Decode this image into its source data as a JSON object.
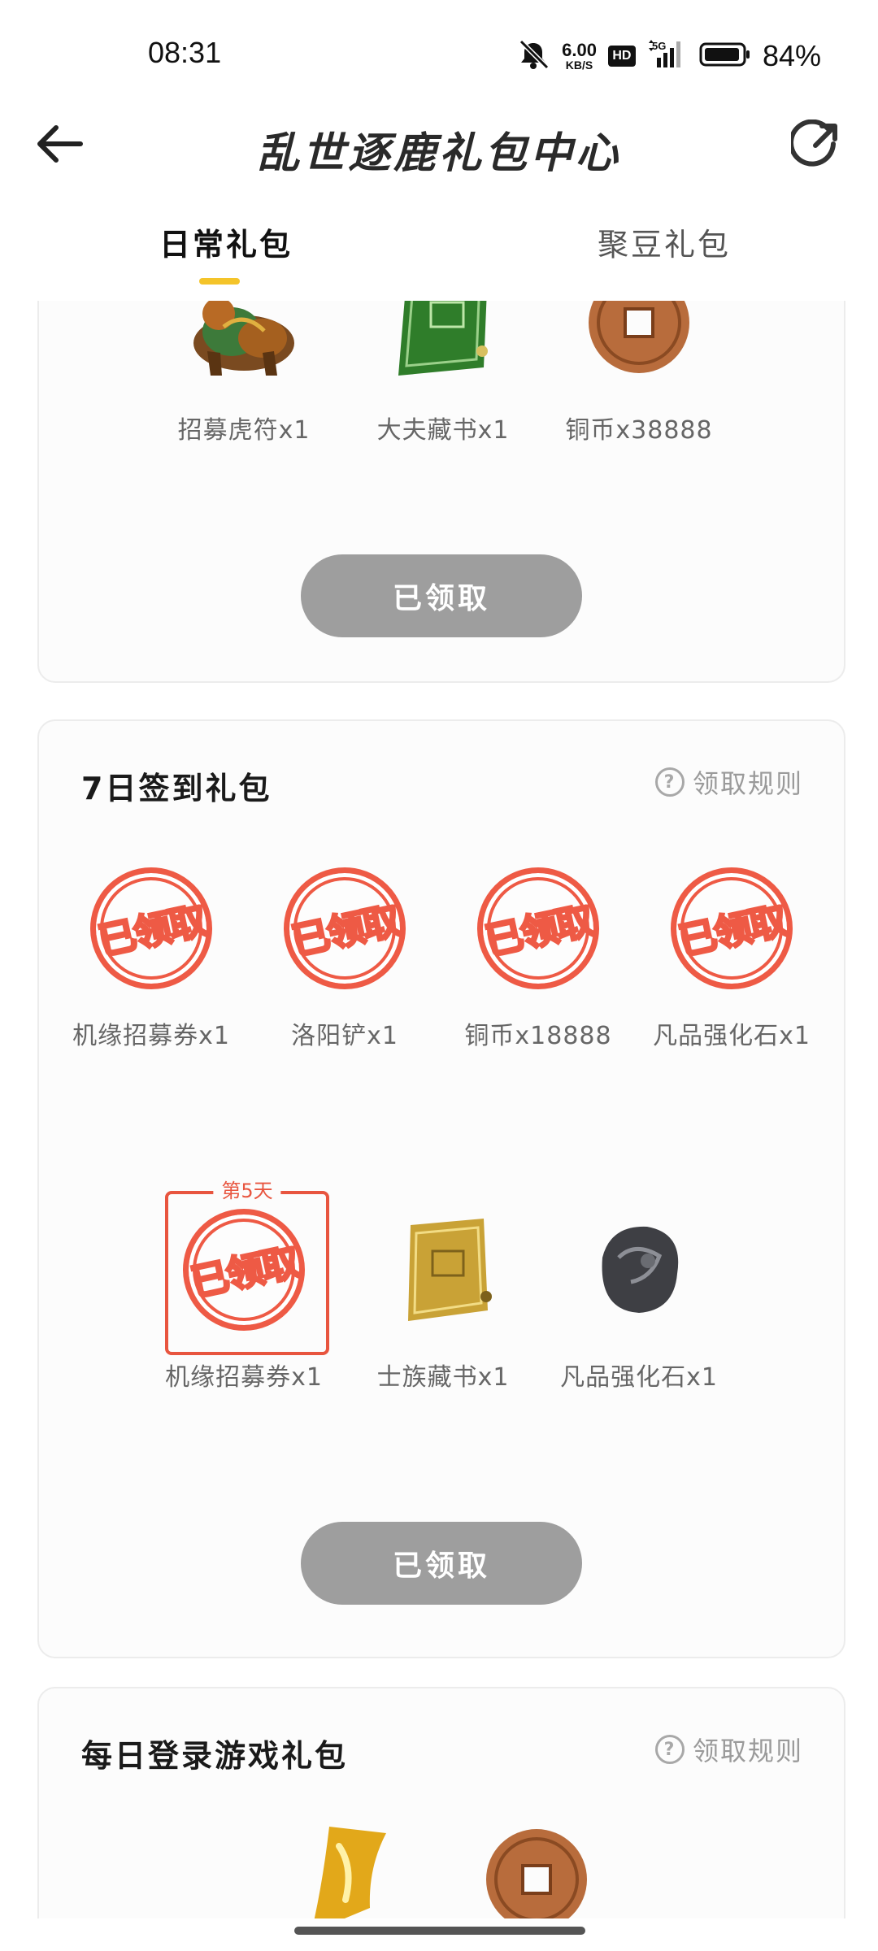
{
  "status_bar": {
    "time": "08:31",
    "net_speed_value": "6.00",
    "net_speed_unit": "KB/S",
    "hd": "HD",
    "signal": "5G",
    "battery": "84%"
  },
  "header": {
    "title": "乱世逐鹿礼包中心"
  },
  "tabs": [
    {
      "label": "日常礼包",
      "active": true
    },
    {
      "label": "聚豆礼包",
      "active": false
    }
  ],
  "cards": {
    "top": {
      "rewards": [
        {
          "label": "招募虎符x1",
          "icon": "tiger-tally-icon"
        },
        {
          "label": "大夫藏书x1",
          "icon": "green-book-icon"
        },
        {
          "label": "铜币x38888",
          "icon": "copper-coin-icon"
        }
      ],
      "button": "已领取"
    },
    "seven_day": {
      "title": "7日签到礼包",
      "rule": "领取规则",
      "rewards": [
        {
          "label": "机缘招募券x1",
          "stamp": "已领取"
        },
        {
          "label": "洛阳铲x1",
          "stamp": "已领取"
        },
        {
          "label": "铜币x18888",
          "stamp": "已领取"
        },
        {
          "label": "凡品强化石x1",
          "stamp": "已领取"
        },
        {
          "label": "机缘招募券x1",
          "stamp": "已领取",
          "day": "第5天"
        },
        {
          "label": "士族藏书x1",
          "icon": "gold-book-icon"
        },
        {
          "label": "凡品强化石x1",
          "icon": "iron-stone-icon"
        }
      ],
      "button": "已领取"
    },
    "daily_login": {
      "title": "每日登录游戏礼包",
      "rule": "领取规则",
      "rewards": [
        {
          "icon": "gold-scroll-icon"
        },
        {
          "icon": "copper-coin-icon"
        }
      ]
    }
  },
  "colors": {
    "accent_yellow": "#f4c42a",
    "stamp_red": "#ee5a45",
    "button_gray": "#9e9e9e"
  }
}
